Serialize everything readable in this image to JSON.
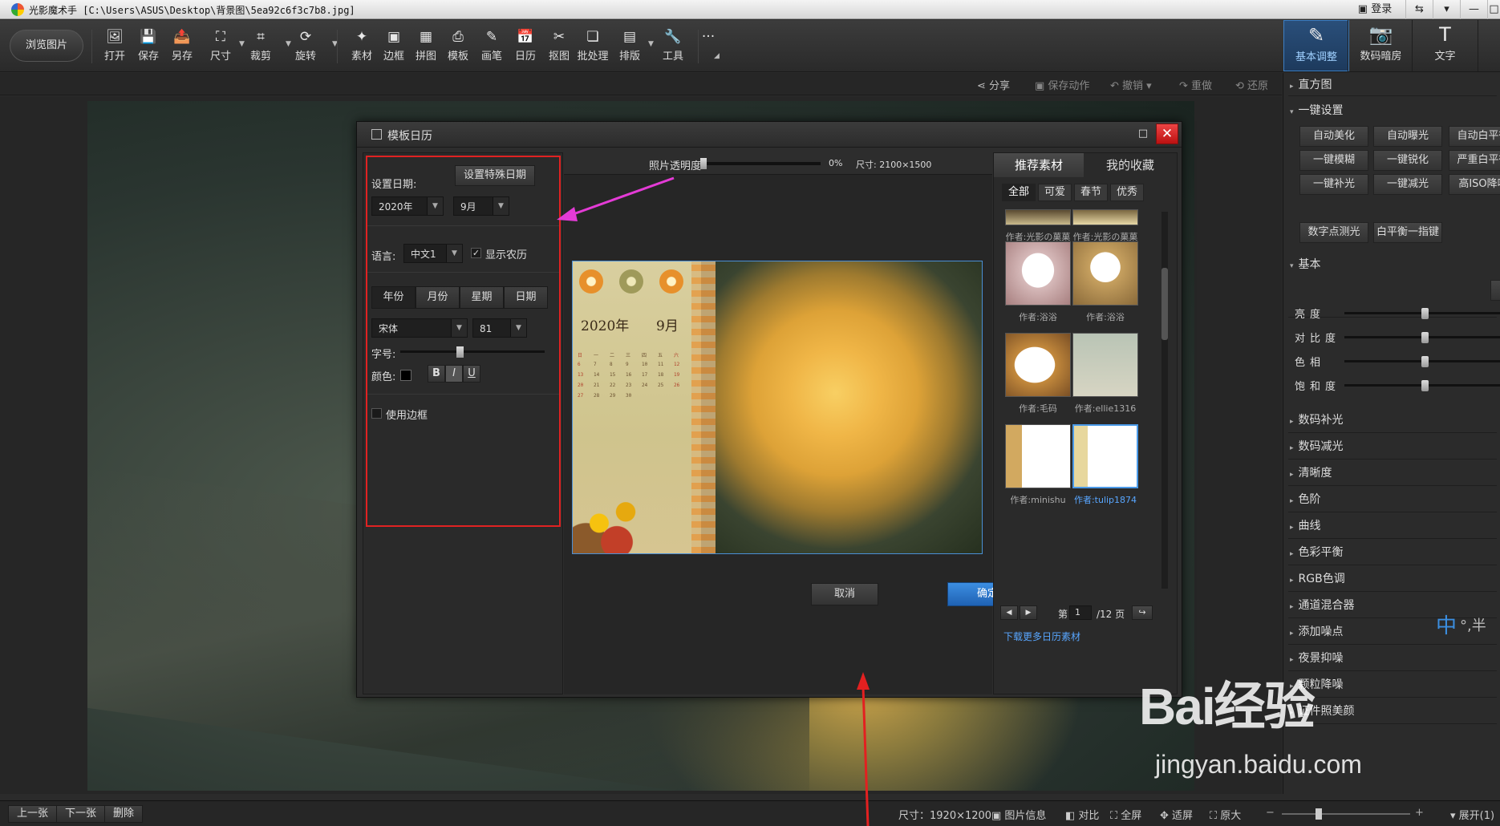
{
  "window": {
    "title": "光影魔术手 [C:\\Users\\ASUS\\Desktop\\背景图\\5ea92c6f3c7b8.jpg]",
    "login": "登录"
  },
  "toolbar": {
    "browse": "浏览图片",
    "tools": [
      {
        "label": "打开",
        "icon": "🖼"
      },
      {
        "label": "保存",
        "icon": "💾"
      },
      {
        "label": "另存",
        "icon": "📤"
      },
      {
        "label": "尺寸",
        "icon": "⛶"
      },
      {
        "label": "裁剪",
        "icon": "⌗"
      },
      {
        "label": "旋转",
        "icon": "⟳"
      },
      {
        "label": "素材",
        "icon": "✦"
      },
      {
        "label": "边框",
        "icon": "▣"
      },
      {
        "label": "拼图",
        "icon": "▦"
      },
      {
        "label": "模板",
        "icon": "⎙"
      },
      {
        "label": "画笔",
        "icon": "✎"
      },
      {
        "label": "日历",
        "icon": "📅"
      },
      {
        "label": "抠图",
        "icon": "✂"
      },
      {
        "label": "批处理",
        "icon": "❏"
      },
      {
        "label": "排版",
        "icon": "▤"
      },
      {
        "label": "工具",
        "icon": "🔧"
      }
    ],
    "more": "···"
  },
  "right_tabs": [
    {
      "label": "基本调整",
      "icon": "✎"
    },
    {
      "label": "数码暗房",
      "icon": "📷"
    },
    {
      "label": "文字",
      "icon": "T"
    }
  ],
  "actions": [
    "分享",
    "保存动作",
    "撤销",
    "重做",
    "还原"
  ],
  "right_panel": {
    "histogram": "直方图",
    "oneclick": "一键设置",
    "oneclick_buttons": [
      "自动美化",
      "自动曝光",
      "自动白平衡",
      "一键模糊",
      "一键锐化",
      "严重白平衡",
      "一键补光",
      "一键减光",
      "高ISO降噪",
      "数字点测光",
      "白平衡一指键"
    ],
    "basic": "基本",
    "sliders": [
      {
        "label": "亮度",
        "value": 0.5
      },
      {
        "label": "对比度",
        "value": 0.5
      },
      {
        "label": "色相",
        "value": 0.5
      },
      {
        "label": "饱和度",
        "value": 0.5
      }
    ],
    "sections": [
      "数码补光",
      "数码减光",
      "清晰度",
      "色阶",
      "曲线",
      "色彩平衡",
      "RGB色调",
      "通道混合器",
      "添加噪点",
      "夜景抑噪",
      "颗粒降噪",
      "证件照美颜"
    ]
  },
  "status": {
    "prev": "上一张",
    "next": "下一张",
    "delete": "删除",
    "size": "尺寸：1920×1200",
    "info": "图片信息",
    "compare": "对比",
    "fullscreen": "全屏",
    "fit": "适屏",
    "original": "原大",
    "expand": "展开(1)"
  },
  "dialog": {
    "title": "模板日历",
    "set_date": "设置日期:",
    "special": "设置特殊日期",
    "year": "2020年",
    "month": "9月",
    "lang_label": "语言:",
    "lang": "中文1",
    "lunar": "显示农历",
    "segments": [
      "年份",
      "月份",
      "星期",
      "日期"
    ],
    "font": "宋体",
    "fontsize": "81",
    "size_label": "字号:",
    "color_label": "颜色:",
    "style_buttons": [
      "B",
      "I",
      "U"
    ],
    "use_border": "使用边框",
    "opacity_label": "照片透明度:",
    "opacity": "0%",
    "dims": "尺寸: 2100×1500",
    "cal_year": "2020年",
    "cal_month": "9月",
    "ok": "确定",
    "cancel": "取消",
    "tabs": [
      "推荐素材",
      "我的收藏"
    ],
    "filters": [
      "全部",
      "可爱",
      "春节",
      "优秀"
    ],
    "authors": [
      [
        "作者:光影の菓菓",
        "作者:光影の菓菓"
      ],
      [
        "作者:浴浴",
        "作者:浴浴"
      ],
      [
        "作者:毛码",
        "作者:ellie1316"
      ],
      [
        "作者:minishu",
        "作者:tulip1874"
      ]
    ],
    "page_label": "第",
    "page": "1",
    "page_total": "/12 页",
    "more_link": "下载更多日历素材"
  },
  "watermark": {
    "brand": "Bai经验",
    "url": "jingyan.baidu.com"
  },
  "ime": {
    "mode": "中",
    "punct": "°,半"
  }
}
